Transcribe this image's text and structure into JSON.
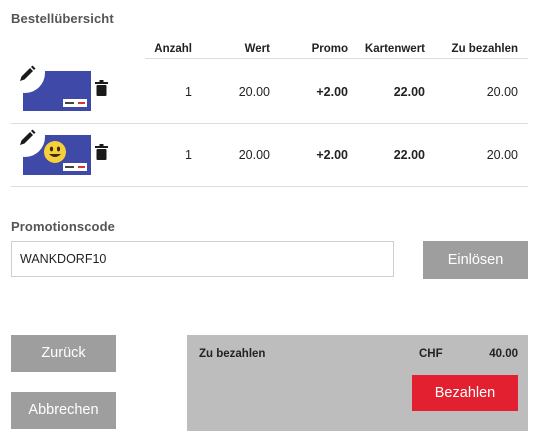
{
  "order_summary": {
    "title": "Bestellübersicht",
    "columns": [
      "Anzahl",
      "Wert",
      "Promo",
      "Kartenwert",
      "Zu bezahlen"
    ],
    "rows": [
      {
        "card": "card-plain",
        "quantity": "1",
        "value": "20.00",
        "promo": "+2.00",
        "card_value": "22.00",
        "to_pay": "20.00"
      },
      {
        "card": "card-smiley",
        "quantity": "1",
        "value": "20.00",
        "promo": "+2.00",
        "card_value": "22.00",
        "to_pay": "20.00"
      }
    ]
  },
  "promotion": {
    "title": "Promotionscode",
    "code_value": "WANKDORF10",
    "redeem_label": "Einlösen"
  },
  "actions": {
    "back_label": "Zurück",
    "cancel_label": "Abbrechen"
  },
  "payment": {
    "label": "Zu bezahlen",
    "currency": "CHF",
    "amount": "40.00",
    "pay_label": "Bezahlen"
  },
  "colors": {
    "card_blue": "#3f49a8",
    "button_gray": "#9e9e9e",
    "pay_box_gray": "#bdbdbd",
    "pay_red": "#e2202f"
  },
  "icons": [
    "pencil-icon",
    "trash-icon",
    "smiley-icon"
  ]
}
